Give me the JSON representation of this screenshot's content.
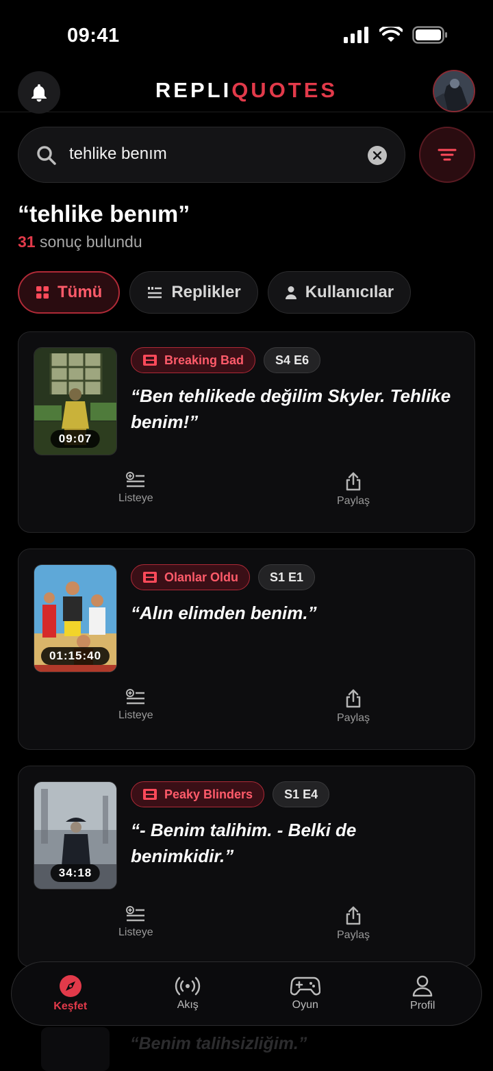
{
  "status_bar": {
    "time": "09:41"
  },
  "header": {
    "logo_part1": "REPLI",
    "logo_part2": "QUOTES"
  },
  "search": {
    "value": "tehlike benım"
  },
  "results": {
    "query_title": "“tehlike benım”",
    "count": "31",
    "count_suffix": " sonuç bulundu"
  },
  "tabs": [
    {
      "label": "Tümü",
      "active": true
    },
    {
      "label": "Replikler",
      "active": false
    },
    {
      "label": "Kullanıcılar",
      "active": false
    }
  ],
  "cards": [
    {
      "show": "Breaking Bad",
      "episode": "S4 E6",
      "timecode": "09:07",
      "quote": "“Ben tehlikede değilim Skyler. Tehlike benim!”",
      "list_label": "Listeye",
      "share_label": "Paylaş"
    },
    {
      "show": "Olanlar Oldu",
      "episode": "S1 E1",
      "timecode": "01:15:40",
      "quote": "“Alın elimden benim.”",
      "list_label": "Listeye",
      "share_label": "Paylaş"
    },
    {
      "show": "Peaky Blinders",
      "episode": "S1 E4",
      "timecode": "34:18",
      "quote": "“- Benim talihim. - Belki de benimkidir.”",
      "list_label": "Listeye",
      "share_label": "Paylaş"
    }
  ],
  "peek": {
    "quote": "“Benim talihsizliğim.”"
  },
  "nav": [
    {
      "label": "Keşfet",
      "icon": "compass-icon",
      "active": true
    },
    {
      "label": "Akış",
      "icon": "broadcast-icon",
      "active": false
    },
    {
      "label": "Oyun",
      "icon": "gamepad-icon",
      "active": false
    },
    {
      "label": "Profil",
      "icon": "user-icon",
      "active": false
    }
  ],
  "colors": {
    "accent": "#e23a4a",
    "background": "#000000",
    "card": "#0d0d0f"
  }
}
